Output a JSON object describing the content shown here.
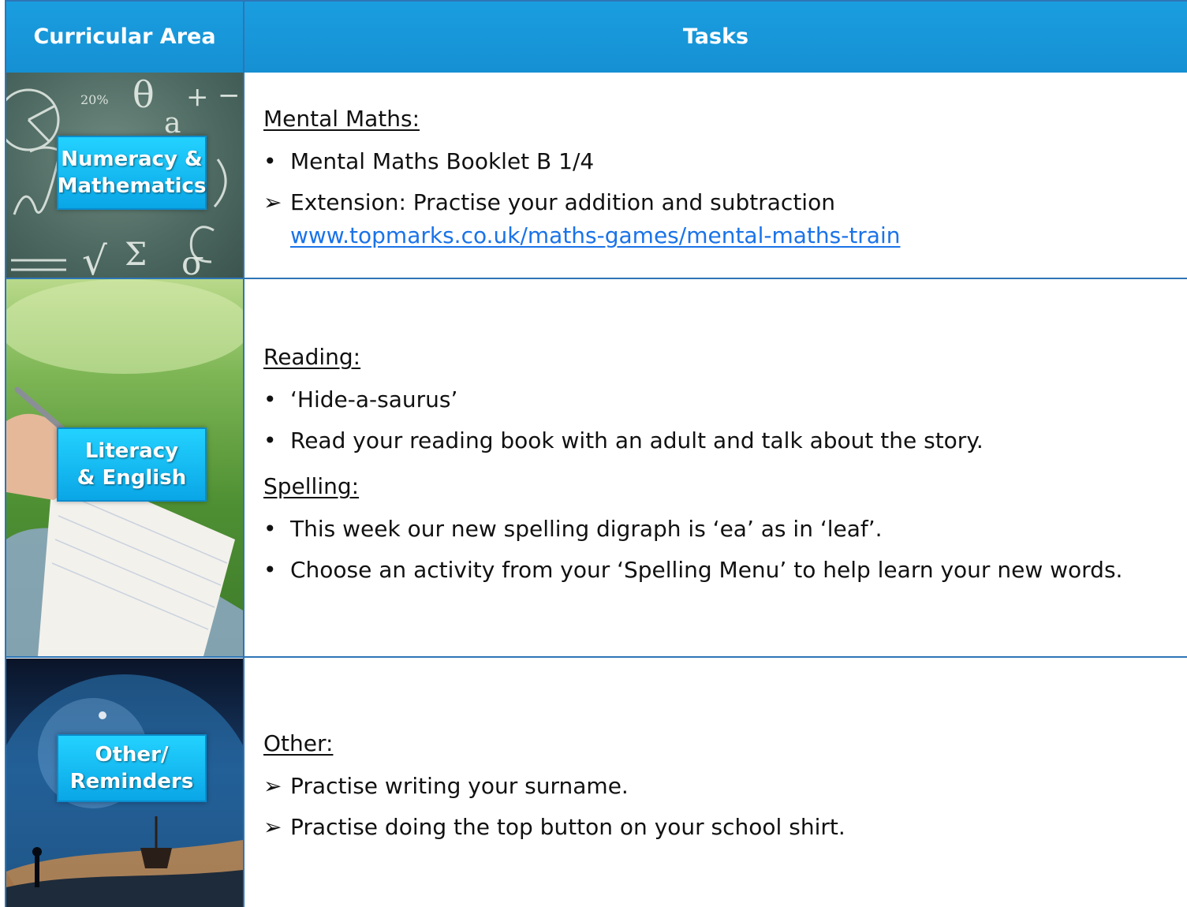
{
  "header": {
    "col1": "Curricular Area",
    "col2": "Tasks"
  },
  "rows": [
    {
      "area_label_line1": "Numeracy &",
      "area_label_line2": "Mathematics",
      "heading": "Mental Maths:",
      "items": [
        {
          "marker": "•",
          "text": "Mental Maths Booklet B 1/4"
        },
        {
          "marker": "➢",
          "text": "Extension: Practise your addition and subtraction"
        }
      ],
      "link": "www.topmarks.co.uk/maths-games/mental-maths-train",
      "chalk_symbols": [
        "20%",
        "θ",
        "a",
        "+",
        "−",
        "√",
        "Σ",
        "σ"
      ]
    },
    {
      "area_label_line1": "Literacy",
      "area_label_line2": "& English",
      "heading1": "Reading:",
      "reading_items": [
        {
          "marker": "•",
          "text": "‘Hide-a-saurus’"
        },
        {
          "marker": "•",
          "text": "Read your reading book with an adult and talk about the story."
        }
      ],
      "heading2": "Spelling:",
      "spelling_items": [
        {
          "marker": "•",
          "text": "This week our new spelling digraph is ‘ea’ as in ‘leaf’."
        },
        {
          "marker": "•",
          "text": "Choose an activity from your ‘Spelling Menu’ to help learn your new words."
        }
      ]
    },
    {
      "area_label_line1": "Other/",
      "area_label_line2": "Reminders",
      "heading": "Other:",
      "items": [
        {
          "marker": "➢",
          "text": "Practise writing your surname."
        },
        {
          "marker": "➢",
          "text": "Practise doing the top button on your school shirt."
        }
      ]
    }
  ]
}
